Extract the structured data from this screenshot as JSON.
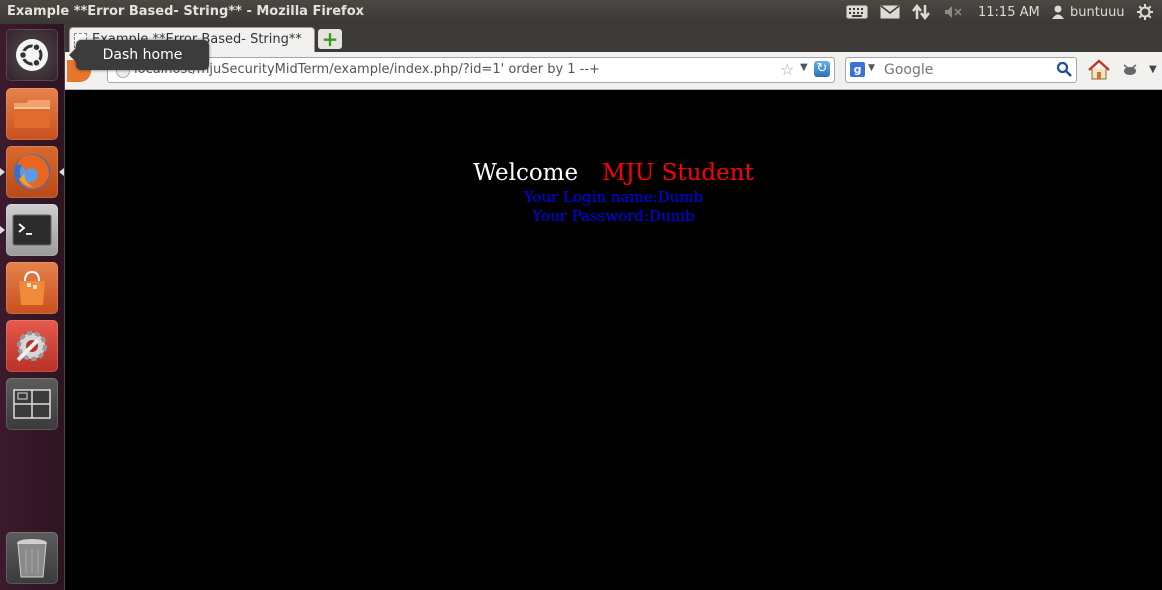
{
  "window": {
    "title": "Example **Error Based- String** - Mozilla Firefox"
  },
  "panel": {
    "time": "11:15 AM",
    "user": "buntuuu"
  },
  "launcher": {
    "tooltip": "Dash home",
    "items": [
      "dash-home",
      "files",
      "firefox",
      "terminal",
      "software-center",
      "system-settings",
      "workspace-switcher",
      "trash"
    ]
  },
  "browser": {
    "tab_title": "Example **Error Based- String**",
    "url": "localhost/mjuSecurityMidTerm/example/index.php/?id=1' order by 1 --+",
    "search_placeholder": "Google"
  },
  "page": {
    "welcome": "Welcome",
    "student": "MJU Student",
    "login_line": "Your Login name:Dumb",
    "password_line": "Your Password:Dumb"
  },
  "colors": {
    "welcome": "#ffffff",
    "student": "#ff0000",
    "credentials": "#0000ff",
    "background": "#000000"
  }
}
